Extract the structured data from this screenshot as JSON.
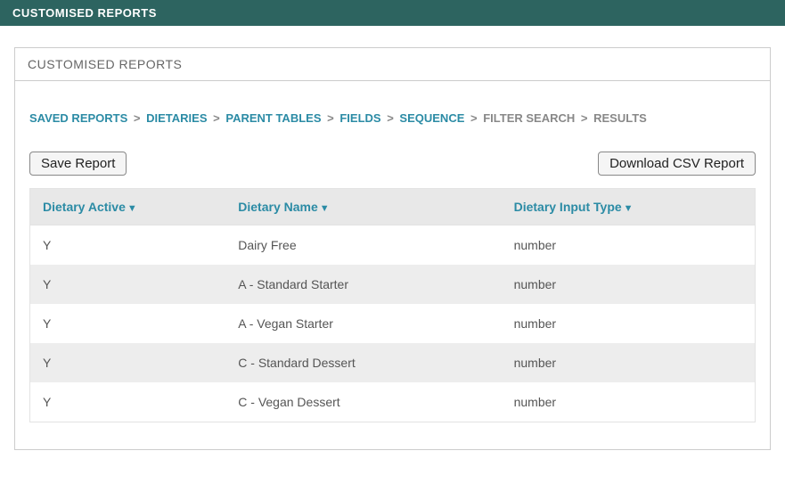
{
  "topbar": {
    "title": "CUSTOMISED REPORTS"
  },
  "panel": {
    "title": "CUSTOMISED REPORTS"
  },
  "breadcrumb": {
    "items": [
      {
        "label": "SAVED REPORTS",
        "active": true
      },
      {
        "label": "DIETARIES",
        "active": true
      },
      {
        "label": "PARENT TABLES",
        "active": true
      },
      {
        "label": "FIELDS",
        "active": true
      },
      {
        "label": "SEQUENCE",
        "active": true
      },
      {
        "label": "FILTER SEARCH",
        "active": false
      },
      {
        "label": "RESULTS",
        "active": false
      }
    ],
    "separator": ">"
  },
  "buttons": {
    "save": "Save Report",
    "download": "Download CSV Report"
  },
  "table": {
    "columns": [
      {
        "label": "Dietary Active",
        "sort": "▼"
      },
      {
        "label": "Dietary Name",
        "sort": "▼"
      },
      {
        "label": "Dietary Input Type",
        "sort": "▼"
      }
    ],
    "rows": [
      {
        "active": "Y",
        "name": "Dairy Free",
        "type": "number"
      },
      {
        "active": "Y",
        "name": "A - Standard Starter",
        "type": "number"
      },
      {
        "active": "Y",
        "name": "A - Vegan Starter",
        "type": "number"
      },
      {
        "active": "Y",
        "name": "C - Standard Dessert",
        "type": "number"
      },
      {
        "active": "Y",
        "name": "C - Vegan Dessert",
        "type": "number"
      }
    ]
  }
}
